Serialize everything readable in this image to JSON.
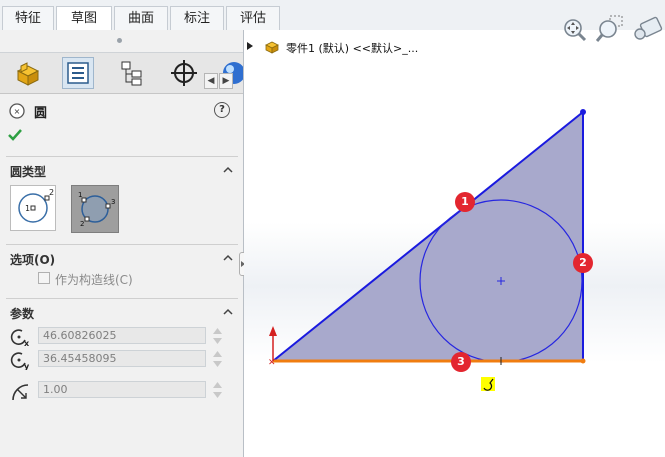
{
  "tabs": [
    {
      "label": "特征",
      "active": false
    },
    {
      "label": "草图",
      "active": true
    },
    {
      "label": "曲面",
      "active": false
    },
    {
      "label": "标注",
      "active": false
    },
    {
      "label": "评估",
      "active": false
    }
  ],
  "command": {
    "title": "圆",
    "help": "?"
  },
  "sections": {
    "circle_type": {
      "title": "圆类型"
    },
    "options": {
      "title": "选项(O)",
      "construction_label": "作为构造线(C)",
      "construction_checked": false
    },
    "parameters": {
      "title": "参数",
      "center_x": "46.60826025",
      "center_y": "36.45458095",
      "radius": "1.00"
    }
  },
  "tree": {
    "root_label": "零件1 (默认) <<默认>_..."
  },
  "markers": [
    "1",
    "2",
    "3"
  ],
  "colors": {
    "sketch_line": "#1a1adf",
    "fill": "#a7a8cb",
    "horizontal_line": "#f07d10",
    "marker": "#e3262f"
  }
}
